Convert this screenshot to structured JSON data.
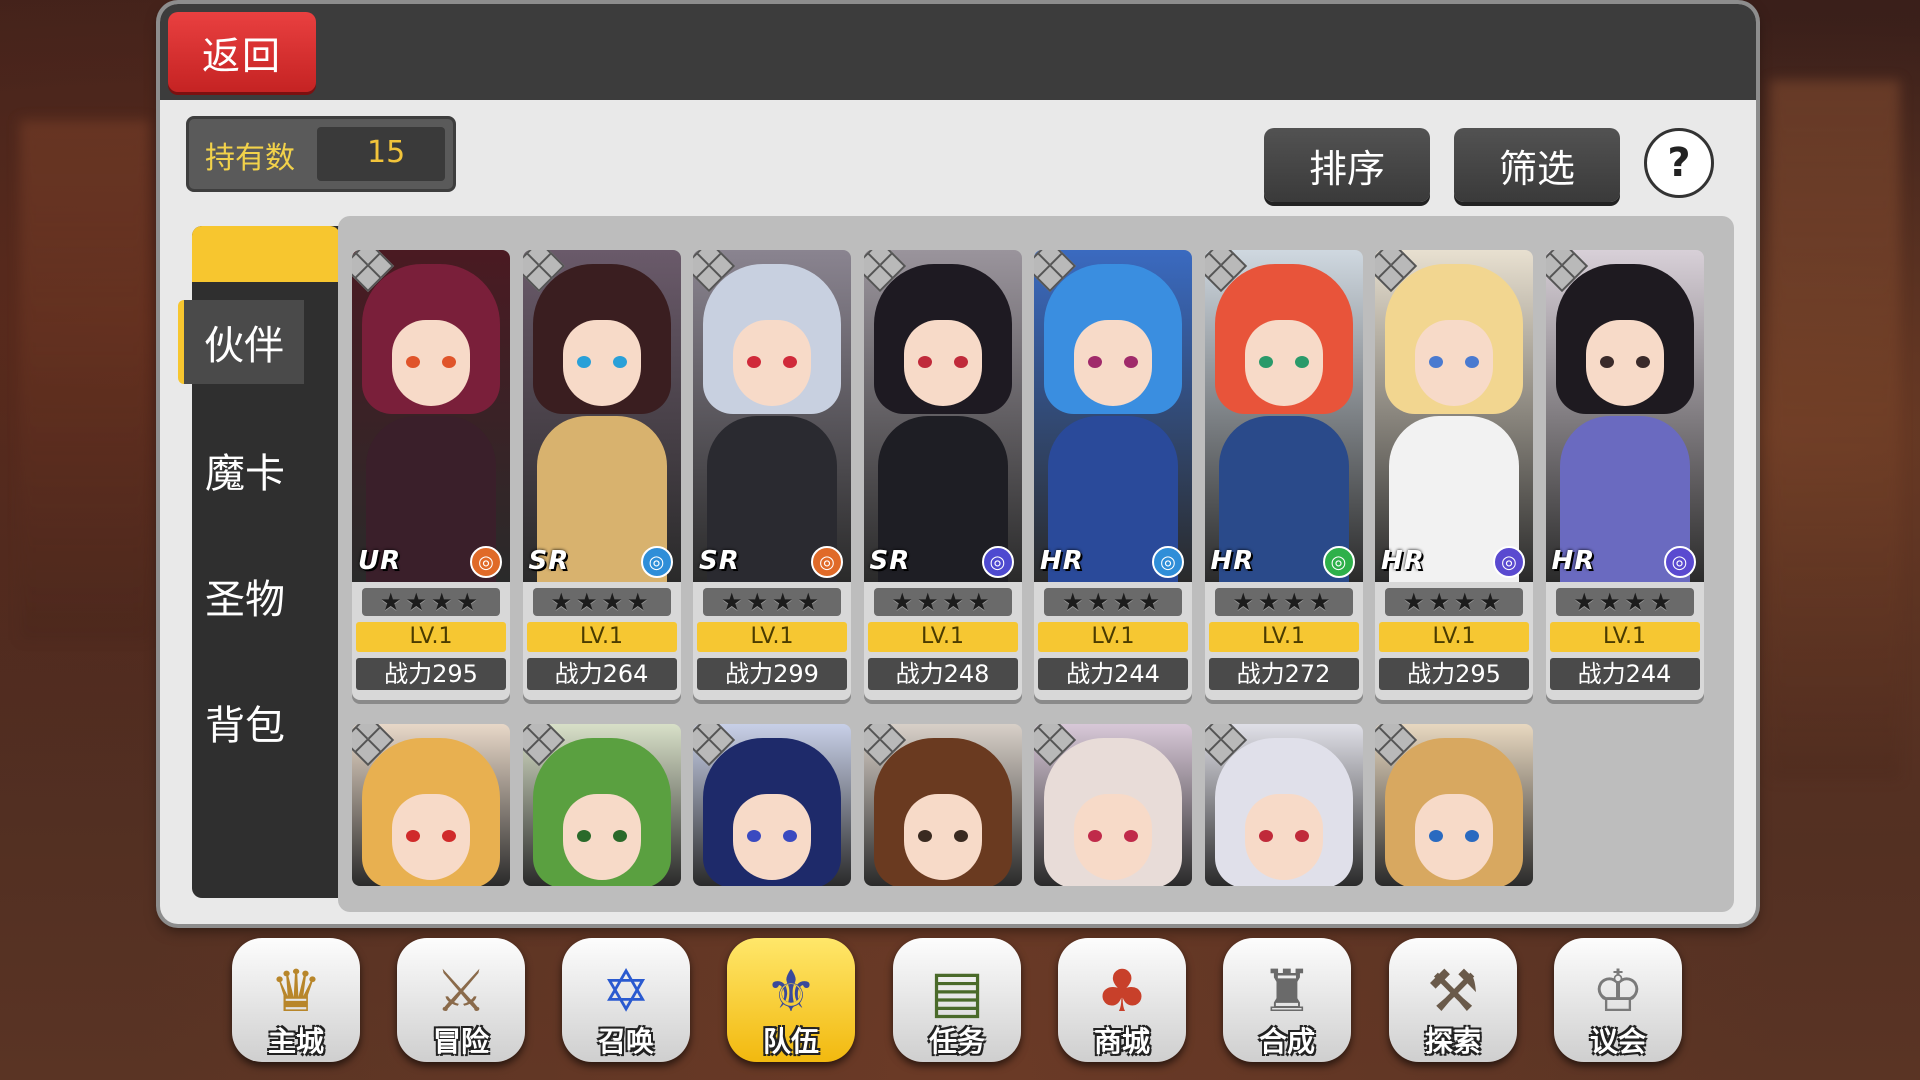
{
  "header": {
    "back_label": "返回"
  },
  "owned": {
    "label": "持有数",
    "value": "15"
  },
  "toolbar": {
    "sort_label": "排序",
    "filter_label": "筛选",
    "help_label": "?"
  },
  "tabs": [
    {
      "label": "伙伴",
      "active": true
    },
    {
      "label": "魔卡",
      "active": false
    },
    {
      "label": "圣物",
      "active": false
    },
    {
      "label": "背包",
      "active": false
    }
  ],
  "cards_row1": [
    {
      "rarity": "UR",
      "element": "fire-icon",
      "stars": "★★★★",
      "level": "LV.1",
      "power": "战力295",
      "hair": "#7a1f3a",
      "outfit": "#3a1f2a",
      "eye": "#e0542a",
      "elem_color": "#e06a28",
      "bg": "#4a1a22"
    },
    {
      "rarity": "SR",
      "element": "water-icon",
      "stars": "★★★★",
      "level": "LV.1",
      "power": "战力264",
      "hair": "#3a1e20",
      "outfit": "#d8b26e",
      "eye": "#2aa0d8",
      "elem_color": "#2f8ed8",
      "bg": "#6a5a6a"
    },
    {
      "rarity": "SR",
      "element": "fire-icon",
      "stars": "★★★★",
      "level": "LV.1",
      "power": "战力299",
      "hair": "#c8d0e0",
      "outfit": "#2a2a30",
      "eye": "#d02a3a",
      "elem_color": "#e06a28",
      "bg": "#8a8490"
    },
    {
      "rarity": "SR",
      "element": "holy-icon",
      "stars": "★★★★",
      "level": "LV.1",
      "power": "战力248",
      "hair": "#1e1a22",
      "outfit": "#1e1e24",
      "eye": "#c02a3a",
      "elem_color": "#4e4ad0",
      "bg": "#9a949c"
    },
    {
      "rarity": "HR",
      "element": "water-icon",
      "stars": "★★★★",
      "level": "LV.1",
      "power": "战力244",
      "hair": "#3a8ee0",
      "outfit": "#2a4a9a",
      "eye": "#a02a6a",
      "elem_color": "#2f8ed8",
      "bg": "#3a6ac0"
    },
    {
      "rarity": "HR",
      "element": "wind-icon",
      "stars": "★★★★",
      "level": "LV.1",
      "power": "战力272",
      "hair": "#e8543a",
      "outfit": "#2a4a8a",
      "eye": "#2a9a6a",
      "elem_color": "#2eb04a",
      "bg": "#cfd8e0"
    },
    {
      "rarity": "HR",
      "element": "dark-icon",
      "stars": "★★★★",
      "level": "LV.1",
      "power": "战力295",
      "hair": "#f2d690",
      "outfit": "#f2f2f2",
      "eye": "#4a7ad0",
      "elem_color": "#5a4ad0",
      "bg": "#e8e0d0"
    },
    {
      "rarity": "HR",
      "element": "dark-icon",
      "stars": "★★★★",
      "level": "LV.1",
      "power": "战力244",
      "hair": "#1e1a20",
      "outfit": "#6a6ac0",
      "eye": "#3a2a2a",
      "elem_color": "#5a4ad0",
      "bg": "#d8d0d8"
    }
  ],
  "cards_row2": [
    {
      "hair": "#e8b050",
      "outfit": "#5a3aa0",
      "eye": "#d02a2a",
      "bg": "#e8d8c8"
    },
    {
      "hair": "#5aa040",
      "outfit": "#c8a040",
      "eye": "#2a6a2a",
      "bg": "#d8e0c8"
    },
    {
      "hair": "#1e2a6a",
      "outfit": "#1e2a6a",
      "eye": "#3a4ac0",
      "bg": "#c8d0e8"
    },
    {
      "hair": "#6a3a20",
      "outfit": "#2a4a2a",
      "eye": "#3a2a20",
      "bg": "#d8d0c8"
    },
    {
      "hair": "#e8dcd8",
      "outfit": "#8a4a8a",
      "eye": "#c02a4a",
      "bg": "#d8c8d8"
    },
    {
      "hair": "#e0e0ea",
      "outfit": "#f0f0f0",
      "eye": "#c02a3a",
      "bg": "#e0e0e8"
    },
    {
      "hair": "#d8a860",
      "outfit": "#c8a040",
      "eye": "#2a6ac0",
      "bg": "#e8d8c0"
    }
  ],
  "nav": [
    {
      "label": "主城",
      "icon": "crown-icon",
      "glyph": "♛",
      "active": false,
      "color": "#b8862a"
    },
    {
      "label": "冒险",
      "icon": "crossed-swords-icon",
      "glyph": "⚔",
      "active": false,
      "color": "#8a6a4a"
    },
    {
      "label": "召唤",
      "icon": "summon-card-icon",
      "glyph": "✡",
      "active": false,
      "color": "#2a5ad0"
    },
    {
      "label": "队伍",
      "icon": "team-wings-icon",
      "glyph": "⚜",
      "active": true,
      "color": "#3a4a9a"
    },
    {
      "label": "任务",
      "icon": "quest-book-icon",
      "glyph": "▤",
      "active": false,
      "color": "#4a6a2a"
    },
    {
      "label": "商城",
      "icon": "shop-tree-icon",
      "glyph": "♣",
      "active": false,
      "color": "#c8402a"
    },
    {
      "label": "合成",
      "icon": "fountain-icon",
      "glyph": "♜",
      "active": false,
      "color": "#6a6a6a"
    },
    {
      "label": "探索",
      "icon": "shovel-icon",
      "glyph": "⚒",
      "active": false,
      "color": "#6a5a4a"
    },
    {
      "label": "议会",
      "icon": "council-crest-icon",
      "glyph": "♔",
      "active": false,
      "color": "#7a7a7a"
    }
  ]
}
